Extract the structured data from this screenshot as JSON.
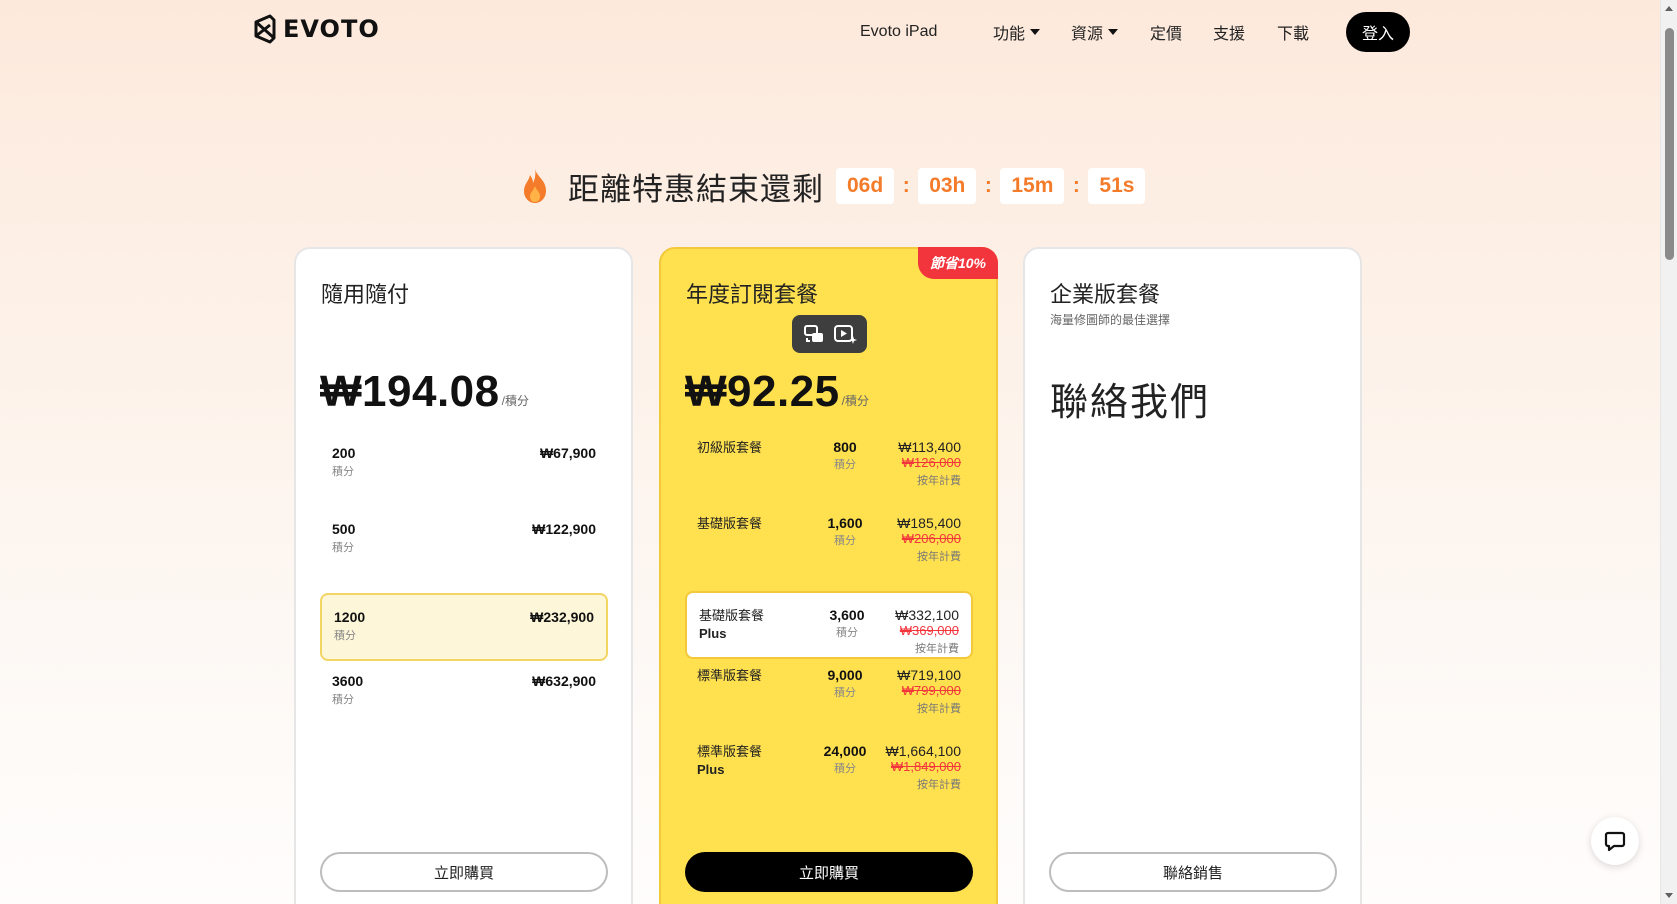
{
  "brand": {
    "name": "EVOTO"
  },
  "nav": {
    "ipad": "Evoto iPad",
    "features": "功能",
    "resources": "資源",
    "pricing": "定價",
    "support": "支援",
    "download": "下載",
    "login": "登入"
  },
  "countdown": {
    "label": "距離特惠結束還剩",
    "days": "06d",
    "hours": "03h",
    "minutes": "15m",
    "seconds": "51s",
    "sep": ":"
  },
  "payg": {
    "title": "隨用隨付",
    "price": "₩194.08",
    "unit": "/積分",
    "credits_label": "積分",
    "rows": [
      {
        "credits": "200",
        "price": "₩67,900"
      },
      {
        "credits": "500",
        "price": "₩122,900"
      },
      {
        "credits": "1200",
        "price": "₩232,900"
      },
      {
        "credits": "3600",
        "price": "₩632,900"
      }
    ],
    "button": "立即購買"
  },
  "annual": {
    "title": "年度訂閱套餐",
    "badge": "節省10%",
    "price": "₩92.25",
    "unit": "/積分",
    "credits_label": "積分",
    "per_year": "按年計費",
    "rows": [
      {
        "plan": "初級版套餐",
        "plan2": "",
        "credits": "800",
        "price": "₩113,400",
        "old": "₩126,000"
      },
      {
        "plan": "基礎版套餐",
        "plan2": "",
        "credits": "1,600",
        "price": "₩185,400",
        "old": "₩206,000"
      },
      {
        "plan": "基礎版套餐",
        "plan2": "Plus",
        "credits": "3,600",
        "price": "₩332,100",
        "old": "₩369,000"
      },
      {
        "plan": "標準版套餐",
        "plan2": "",
        "credits": "9,000",
        "price": "₩719,100",
        "old": "₩799,000"
      },
      {
        "plan": "標準版套餐",
        "plan2": "Plus",
        "credits": "24,000",
        "price": "₩1,664,100",
        "old": "₩1,849,000"
      }
    ],
    "button": "立即購買"
  },
  "enterprise": {
    "title": "企業版套餐",
    "subtitle": "海量修圖師的最佳選擇",
    "contact": "聯絡我們",
    "button": "聯絡銷售"
  },
  "colors": {
    "accent_orange": "#f47b2a",
    "card_yellow": "#ffe04f",
    "badge_red": "#f2353c",
    "selected_bg": "#fdf6d8"
  }
}
